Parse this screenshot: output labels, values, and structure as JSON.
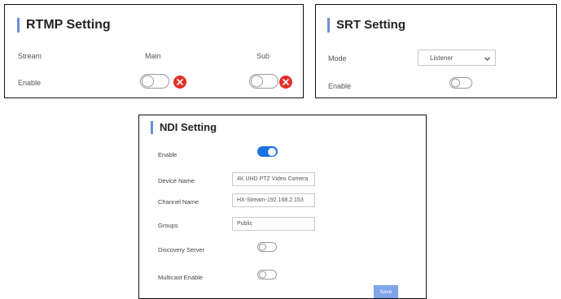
{
  "rtmp": {
    "title": "RTMP Setting",
    "stream_label": "Stream",
    "main_label": "Main",
    "sub_label": "Sub",
    "enable_label": "Enable",
    "main_enabled": false,
    "sub_enabled": false
  },
  "srt": {
    "title": "SRT Setting",
    "mode_label": "Mode",
    "mode_value": "Listener",
    "enable_label": "Enable",
    "enabled": false
  },
  "ndi": {
    "title": "NDI Setting",
    "enable_label": "Enable",
    "enabled": true,
    "device_name_label": "Device Name",
    "device_name_value": "4K UHD PTZ Video Camera",
    "channel_name_label": "Channel Name",
    "channel_name_value": "HX-Stream-192.168.2.153",
    "groups_label": "Groups",
    "groups_value": "Public",
    "discovery_server_label": "Discovery Server",
    "discovery_server_enabled": false,
    "multicast_enable_label": "Multicast Enable",
    "multicast_enabled": false,
    "save_label": "Save"
  },
  "colors": {
    "accent": "#1b73e8",
    "title_bar": "#6b8fd6",
    "remove": "#e23028",
    "save": "#7fa4e8"
  },
  "icons": [
    "remove-icon",
    "chevron-down-icon"
  ]
}
